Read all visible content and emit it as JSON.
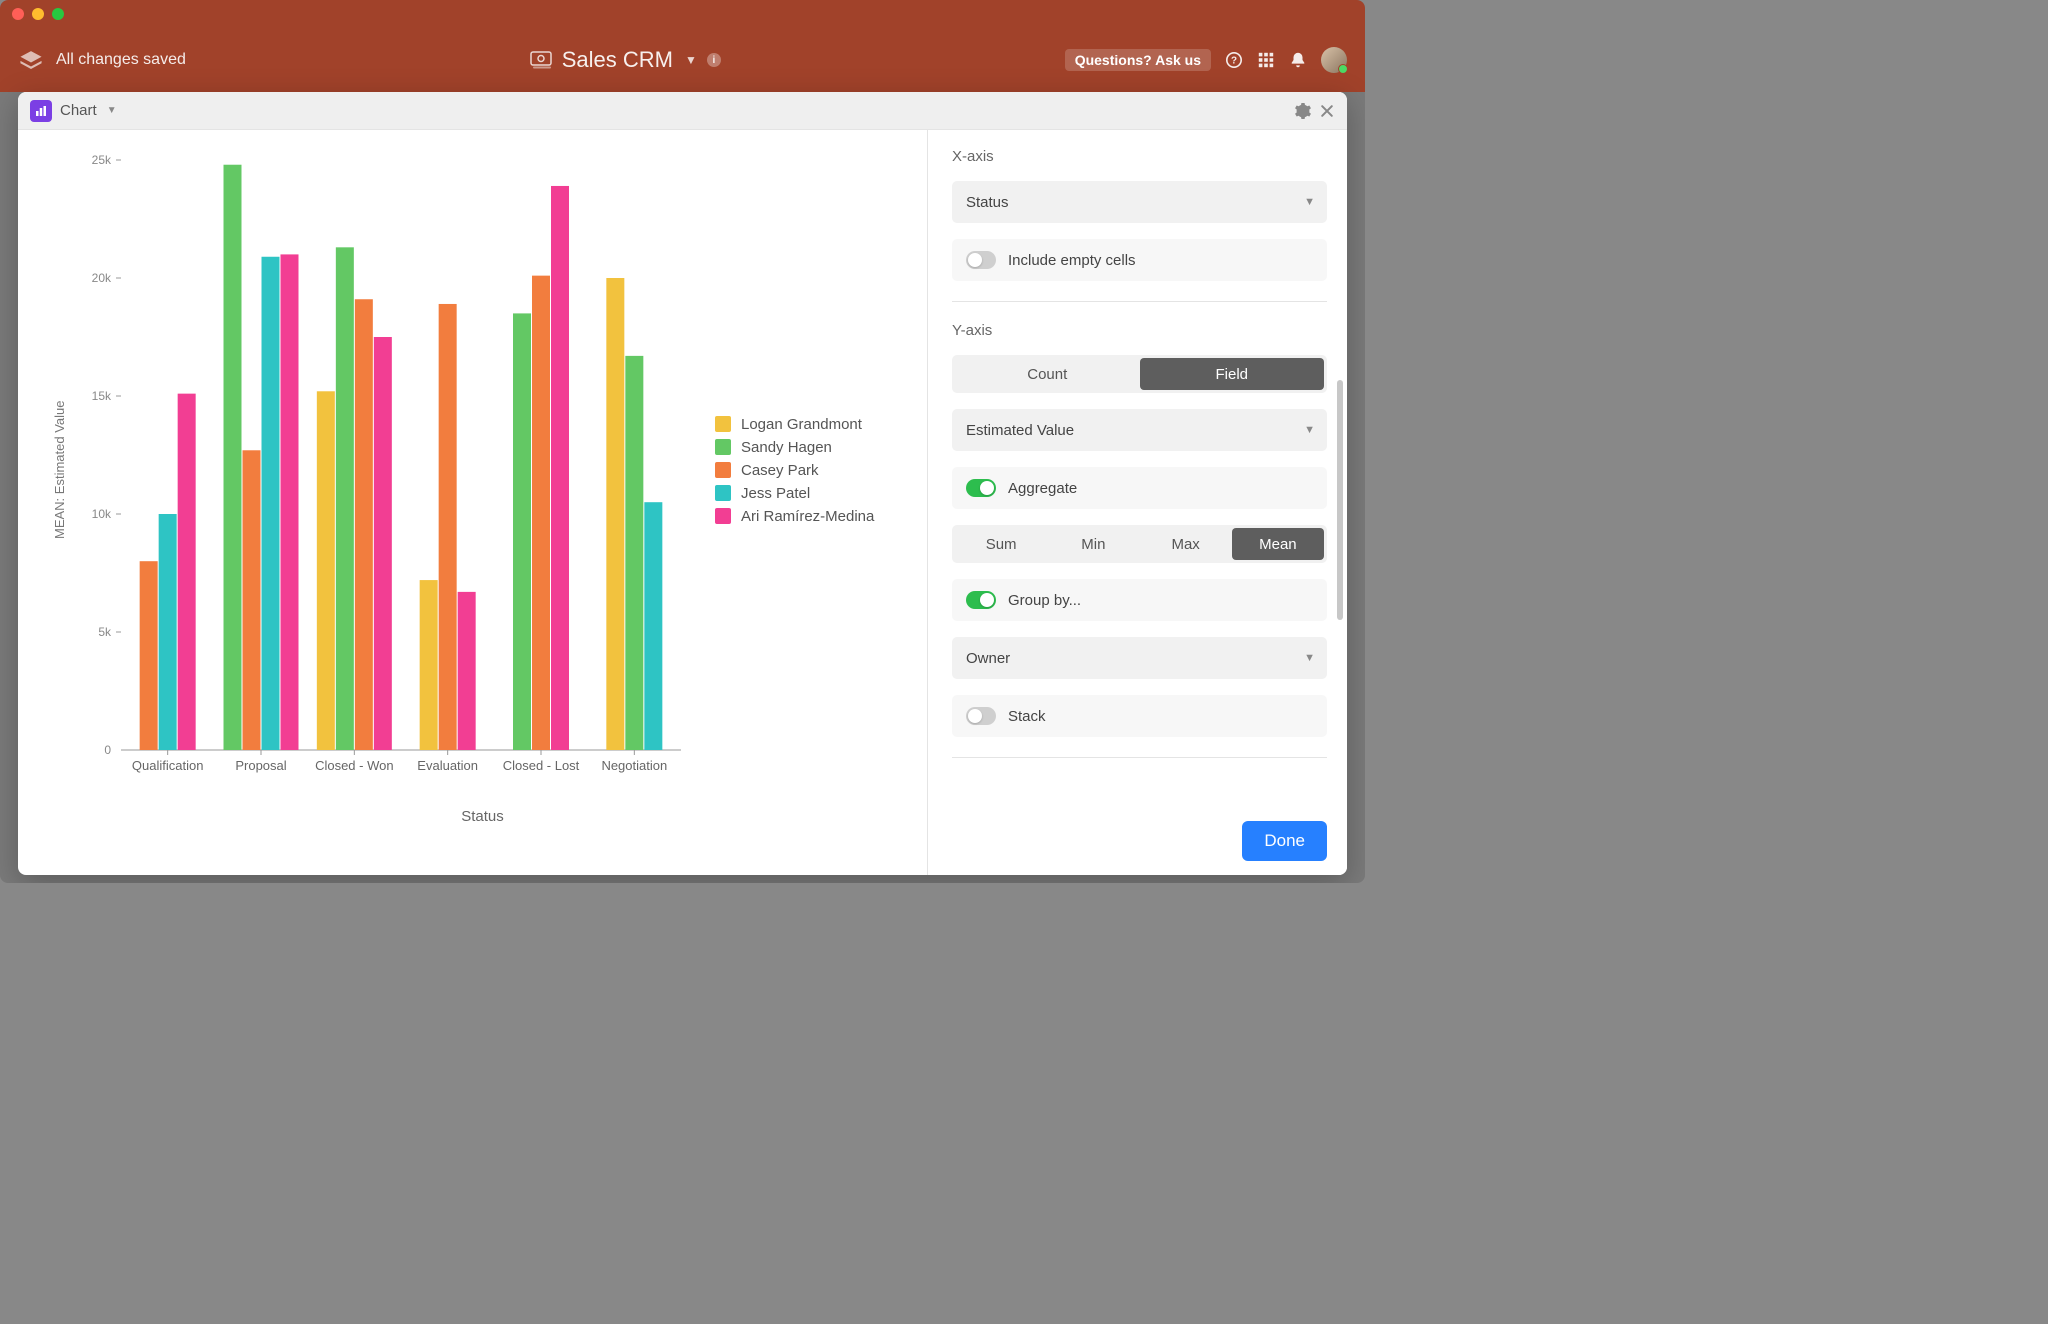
{
  "header": {
    "status_text": "All changes saved",
    "title": "Sales CRM",
    "help_badge": "Questions? Ask us"
  },
  "panel": {
    "title": "Chart"
  },
  "sidebar": {
    "xaxis_label": "X-axis",
    "xaxis_value": "Status",
    "include_empty_label": "Include empty cells",
    "yaxis_label": "Y-axis",
    "yaxis_seg_count": "Count",
    "yaxis_seg_field": "Field",
    "yaxis_field_value": "Estimated Value",
    "aggregate_label": "Aggregate",
    "agg_sum": "Sum",
    "agg_min": "Min",
    "agg_max": "Max",
    "agg_mean": "Mean",
    "groupby_label": "Group by...",
    "groupby_value": "Owner",
    "stack_label": "Stack",
    "done_label": "Done"
  },
  "chart_data": {
    "type": "bar",
    "xlabel": "Status",
    "ylabel": "MEAN: Estimated Value",
    "ylim": [
      0,
      25000
    ],
    "yticks": [
      5000,
      10000,
      15000,
      20000,
      25000
    ],
    "ytick_labels": [
      "5k",
      "10k",
      "15k",
      "20k",
      "25k"
    ],
    "categories": [
      "Qualification",
      "Proposal",
      "Closed - Won",
      "Evaluation",
      "Closed - Lost",
      "Negotiation"
    ],
    "series": [
      {
        "name": "Logan Grandmont",
        "color": "#f2c23e",
        "values": [
          null,
          null,
          15200,
          7200,
          null,
          20000
        ]
      },
      {
        "name": "Sandy Hagen",
        "color": "#63c864",
        "values": [
          null,
          24800,
          21300,
          null,
          18500,
          16700
        ]
      },
      {
        "name": "Casey Park",
        "color": "#f27d3e",
        "values": [
          8000,
          12700,
          19100,
          18900,
          20100,
          null
        ]
      },
      {
        "name": "Jess Patel",
        "color": "#2ec4c4",
        "values": [
          10000,
          20900,
          null,
          null,
          null,
          10500
        ]
      },
      {
        "name": "Ari Ramírez-Medina",
        "color": "#f23e93",
        "values": [
          15100,
          21000,
          17500,
          6700,
          23900,
          null
        ]
      }
    ]
  }
}
